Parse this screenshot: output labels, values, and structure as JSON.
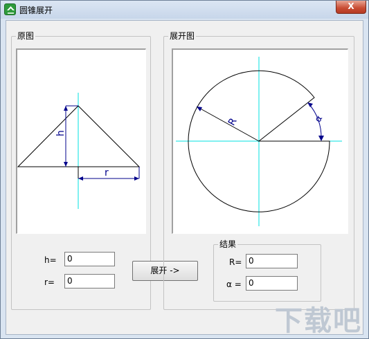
{
  "window": {
    "title": "圆锥展开",
    "close_label": "X"
  },
  "original": {
    "label": "原图",
    "h_label": "h=",
    "r_label": "r=",
    "h_value": "0",
    "r_value": "0",
    "diagram_h": "h",
    "diagram_r": "r"
  },
  "expand_button": {
    "label": "展开 ->"
  },
  "unfolded": {
    "label": "展开图",
    "diagram_R": "R",
    "diagram_alpha": "α"
  },
  "result": {
    "label": "结果",
    "R_label": "R=",
    "alpha_label": "α =",
    "R_value": "0",
    "alpha_value": "0"
  },
  "watermark": {
    "text": "下载吧"
  },
  "colors": {
    "axis": "#00e0e0",
    "dimension": "#00008b",
    "outline": "#000000"
  }
}
